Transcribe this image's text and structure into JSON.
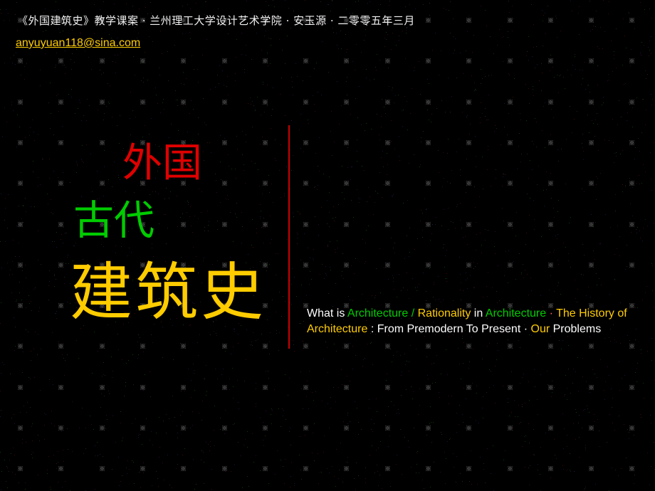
{
  "header": {
    "title": "《外国建筑史》教学课案 · 兰州理工大学设计艺术学院 · 安玉源 · 二零零五年三月",
    "email": "anyuyuan118@sina.com"
  },
  "title": {
    "line1": "外国",
    "line2": "古代",
    "line3": "建筑史"
  },
  "subtitle": {
    "segments": [
      {
        "text": "What is ",
        "color": "#ffffff"
      },
      {
        "text": "Architecture / ",
        "color": "#00cc00"
      },
      {
        "text": "Rationality",
        "color": "#ffcc00"
      },
      {
        "text": " in ",
        "color": "#ffffff"
      },
      {
        "text": "Architecture",
        "color": "#00cc00"
      },
      {
        "text": " · ",
        "color": "#ff6666"
      },
      {
        "text": "The History of Architecture",
        "color": "#ffcc00"
      },
      {
        "text": " : From Premodern To Present · ",
        "color": "#ffffff"
      },
      {
        "text": "Our",
        "color": "#ffcc00"
      },
      {
        "text": " Problems",
        "color": "#ffffff"
      }
    ]
  },
  "colors": {
    "background": "#000000",
    "title_red": "#e00000",
    "title_green": "#00cc00",
    "title_yellow": "#ffcc00",
    "divider": "#cc0000",
    "link": "#ffcc00"
  }
}
